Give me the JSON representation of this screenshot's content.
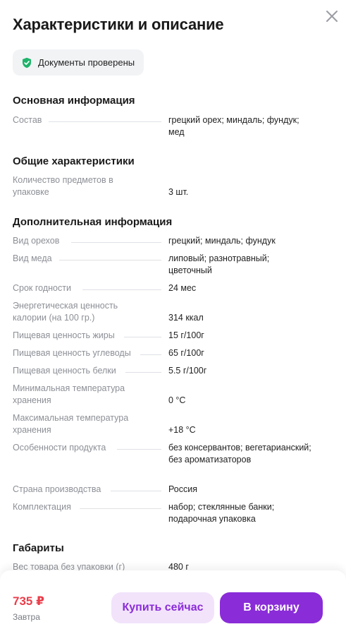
{
  "header": {
    "title": "Характеристики и описание"
  },
  "badge": {
    "label": "Документы проверены",
    "color": "#1fb36b"
  },
  "sections": [
    {
      "title": "Основная информация",
      "rows": [
        {
          "label": "Состав",
          "value": "грецкий орех; миндаль; фундук; мед"
        }
      ]
    },
    {
      "title": "Общие характеристики",
      "rows": [
        {
          "label": "Количество предметов в упаковке",
          "value": "3 шт."
        }
      ]
    },
    {
      "title": "Дополнительная информация",
      "rows": [
        {
          "label": "Вид орехов",
          "value": "грецкий; миндаль; фундук"
        },
        {
          "label": "Вид меда",
          "value": "липовый; разнотравный; цветочный"
        },
        {
          "label": "Срок годности",
          "value": "24 мес"
        },
        {
          "label": "Энергетическая ценность калории (на 100 гр.)",
          "value": "314 ккал"
        },
        {
          "label": "Пищевая ценность жиры",
          "value": "15 г/100г"
        },
        {
          "label": "Пищевая ценность углеводы",
          "value": "65 г/100г"
        },
        {
          "label": "Пищевая ценность белки",
          "value": "5.5 г/100г"
        },
        {
          "label": "Минимальная температура хранения",
          "value": "0 °C"
        },
        {
          "label": "Максимальная температура хранения",
          "value": "+18 °C"
        },
        {
          "label": "Особенности продукта",
          "value": "без консервантов; вегетарианский; без ароматизаторов"
        },
        {
          "label": "Страна производства",
          "value": "Россия"
        },
        {
          "label": "Комплектация",
          "value": "набор; стеклянные банки; подарочная упаковка"
        }
      ]
    },
    {
      "title": "Габариты",
      "rows": [
        {
          "label": "Вес товара без упаковки (г)",
          "value": "480 г"
        }
      ]
    }
  ],
  "footer": {
    "price": "735 ₽",
    "delivery": "Завтра",
    "buy_now_label": "Купить сейчас",
    "add_to_cart_label": "В корзину"
  },
  "colors": {
    "accent": "#8a2cd8",
    "accent_light": "#f2e3fb",
    "price": "#ea3d4a"
  },
  "icons": {
    "close": "close-icon",
    "badge": "shield-check-icon"
  }
}
